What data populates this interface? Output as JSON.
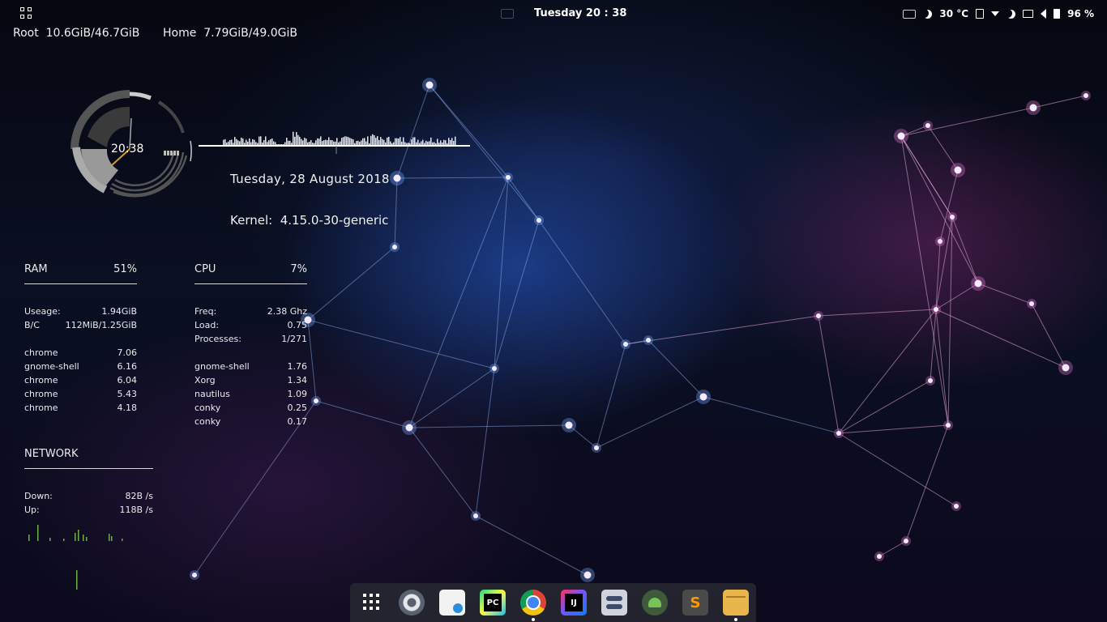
{
  "topbar": {
    "clock": "Tuesday 20 : 38",
    "temperature": "30 °C",
    "battery": "96 %",
    "icons": [
      "keyboard-icon",
      "night-light-icon",
      "clipboard-icon",
      "dropdown-icon",
      "moon-icon",
      "screen-icon",
      "volume-icon",
      "battery-icon"
    ]
  },
  "disk": {
    "root_label": "Root",
    "root_value": "10.6GiB/46.7GiB",
    "home_label": "Home",
    "home_value": "7.79GiB/49.0GiB"
  },
  "widget": {
    "time": "20:38",
    "date": "Tuesday, 28 August 2018",
    "kernel_label": "Kernel:",
    "kernel_value": "4.15.0-30-generic"
  },
  "ram": {
    "title": "RAM",
    "percent": "51%",
    "stats": [
      {
        "label": "Useage:",
        "value": "1.94GiB"
      },
      {
        "label": "B/C",
        "value": "112MiB/1.25GiB"
      }
    ],
    "processes": [
      {
        "name": "chrome",
        "value": "7.06"
      },
      {
        "name": "gnome-shell",
        "value": "6.16"
      },
      {
        "name": "chrome",
        "value": "6.04"
      },
      {
        "name": "chrome",
        "value": "5.43"
      },
      {
        "name": "chrome",
        "value": "4.18"
      }
    ]
  },
  "cpu": {
    "title": "CPU",
    "percent": "7%",
    "stats": [
      {
        "label": "Freq:",
        "value": "2.38 Ghz"
      },
      {
        "label": "Load:",
        "value": "0.75"
      },
      {
        "label": "Processes:",
        "value": "1/271"
      }
    ],
    "processes": [
      {
        "name": "gnome-shell",
        "value": "1.76"
      },
      {
        "name": "Xorg",
        "value": "1.34"
      },
      {
        "name": "nautilus",
        "value": "1.09"
      },
      {
        "name": "conky",
        "value": "0.25"
      },
      {
        "name": "conky",
        "value": "0.17"
      }
    ]
  },
  "network": {
    "title": "NETWORK",
    "down_label": "Down:",
    "down_value": "82B /s",
    "up_label": "Up:",
    "up_value": "118B /s"
  },
  "dock": {
    "items": [
      {
        "name": "show-apps",
        "label": "",
        "color": "transparent",
        "running": false
      },
      {
        "name": "settings",
        "label": "",
        "color": "#5a6270",
        "running": false
      },
      {
        "name": "software-store",
        "label": "",
        "color": "#f2f2f2",
        "running": false
      },
      {
        "name": "pycharm",
        "label": "PC",
        "color": "#21d789",
        "running": false
      },
      {
        "name": "chrome",
        "label": "",
        "color": "#db4437",
        "running": true
      },
      {
        "name": "intellij",
        "label": "IJ",
        "color": "#6b57ff",
        "running": false
      },
      {
        "name": "tweaks",
        "label": "",
        "color": "#cfd4dc",
        "running": false
      },
      {
        "name": "android-studio",
        "label": "",
        "color": "#78c257",
        "running": false
      },
      {
        "name": "sublime-text",
        "label": "S",
        "color": "#ff9800",
        "running": false
      },
      {
        "name": "files",
        "label": "",
        "color": "#e9b64e",
        "running": true
      }
    ]
  }
}
